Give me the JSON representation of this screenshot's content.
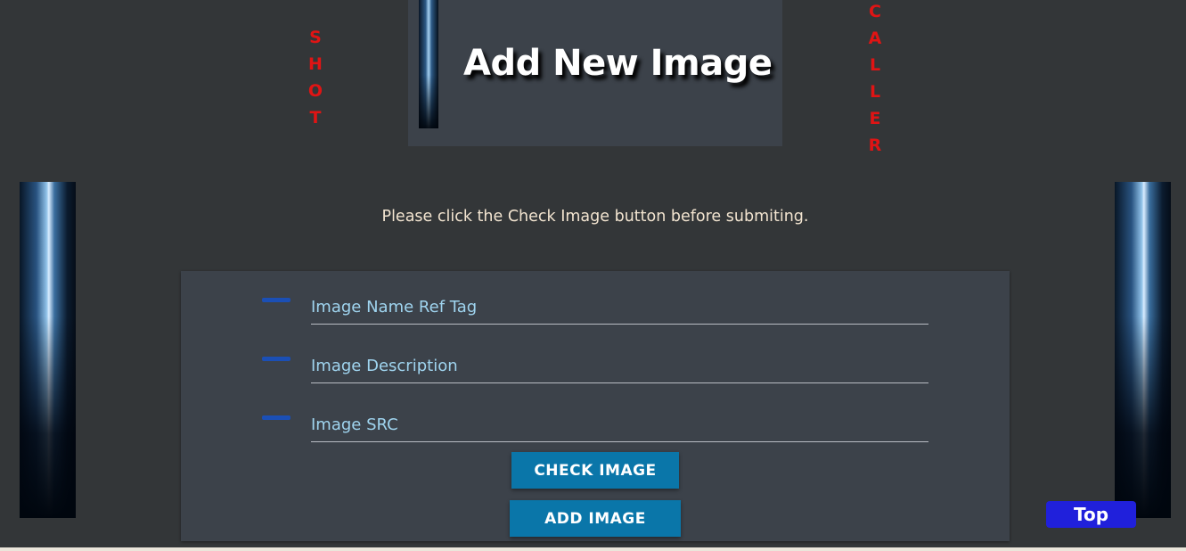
{
  "side_words": {
    "left": [
      "S",
      "H",
      "O",
      "T"
    ],
    "right": [
      "C",
      "A",
      "L",
      "L",
      "E",
      "R"
    ]
  },
  "header": {
    "title": "Add New Image"
  },
  "notice": "Please click the Check Image button before submiting.",
  "form": {
    "fields": [
      {
        "placeholder": "Image Name Ref Tag",
        "value": ""
      },
      {
        "placeholder": "Image Description",
        "value": ""
      },
      {
        "placeholder": "Image SRC",
        "value": ""
      }
    ],
    "check_label": "CHECK IMAGE",
    "add_label": "ADD IMAGE"
  },
  "top_button_label": "Top",
  "colors": {
    "background": "#333638",
    "panel": "#3c424a",
    "accent_red": "#e01414",
    "button_blue": "#0a76a9",
    "top_button": "#2020db",
    "field_dash": "#1b4fb5",
    "field_text": "#9fd4ef",
    "notice_text": "#f2e4d0"
  }
}
